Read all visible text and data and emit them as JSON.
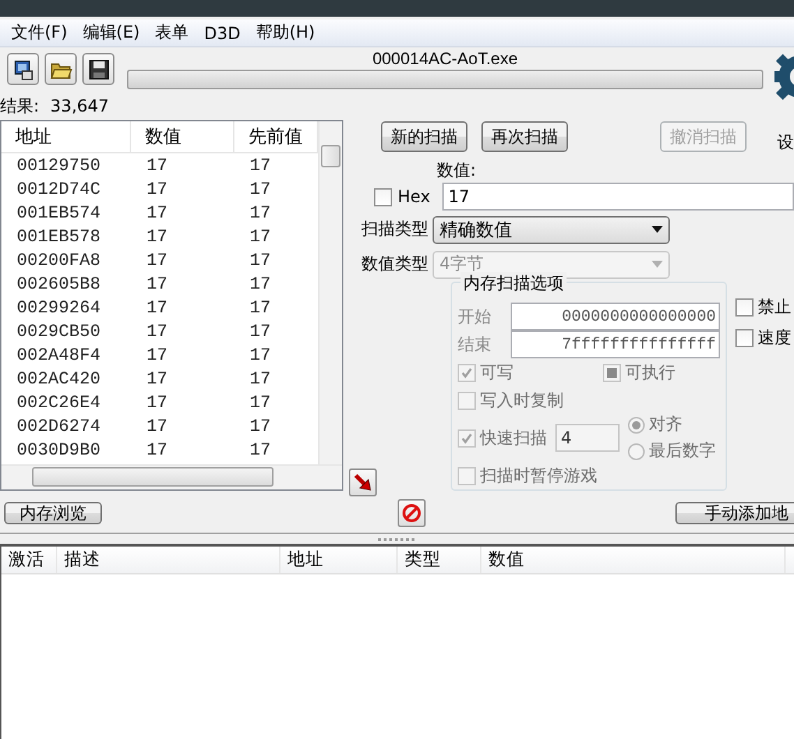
{
  "menu": [
    {
      "label": "文件(F)"
    },
    {
      "label": "编辑(E)"
    },
    {
      "label": "表单"
    },
    {
      "label": "D3D"
    },
    {
      "label": "帮助(H)"
    }
  ],
  "toolbar": {
    "process_name": "000014AC-AoT.exe",
    "progress": {
      "level": 0
    },
    "settings_label": "设"
  },
  "results": {
    "label": "结果:",
    "count": "33,647"
  },
  "scan_list": {
    "columns": [
      "地址",
      "数值",
      "先前值"
    ],
    "rows": [
      {
        "address": "00129750",
        "value": "17",
        "previous": "17"
      },
      {
        "address": "0012D74C",
        "value": "17",
        "previous": "17"
      },
      {
        "address": "001EB574",
        "value": "17",
        "previous": "17"
      },
      {
        "address": "001EB578",
        "value": "17",
        "previous": "17"
      },
      {
        "address": "00200FA8",
        "value": "17",
        "previous": "17"
      },
      {
        "address": "002605B8",
        "value": "17",
        "previous": "17"
      },
      {
        "address": "00299264",
        "value": "17",
        "previous": "17"
      },
      {
        "address": "0029CB50",
        "value": "17",
        "previous": "17"
      },
      {
        "address": "002A48F4",
        "value": "17",
        "previous": "17"
      },
      {
        "address": "002AC420",
        "value": "17",
        "previous": "17"
      },
      {
        "address": "002C26E4",
        "value": "17",
        "previous": "17"
      },
      {
        "address": "002D6274",
        "value": "17",
        "previous": "17"
      },
      {
        "address": "0030D9B0",
        "value": "17",
        "previous": "17"
      }
    ]
  },
  "scan_buttons": [
    {
      "label": "新的扫描",
      "disabled": false
    },
    {
      "label": "再次扫描",
      "disabled": false
    },
    {
      "label": "撤消扫描",
      "disabled": true
    }
  ],
  "value": {
    "label": "数值:",
    "hex": {
      "label": "Hex",
      "checked": false
    },
    "input": "17"
  },
  "scan_type": {
    "label": "扫描类型",
    "value": "精确数值",
    "disabled": false
  },
  "value_type": {
    "label": "数值类型",
    "value": "4字节",
    "disabled": true
  },
  "memory_scan_options": {
    "title": "内存扫描选项",
    "disabled": true,
    "start": {
      "label": "开始",
      "value": "0000000000000000"
    },
    "end": {
      "label": "结束",
      "value": "7fffffffffffffff"
    },
    "writable": {
      "label": "可写",
      "checked": true
    },
    "executable": {
      "label": "可执行",
      "indeterminate": true
    },
    "copy_on_write": {
      "label": "写入时复制",
      "checked": false
    },
    "fast_scan": {
      "label": "快速扫描",
      "checked": true,
      "value": "4"
    },
    "alignment": [
      {
        "label": "对齐",
        "selected": true
      },
      {
        "label": "最后数字",
        "selected": false
      }
    ],
    "pause_game": {
      "label": "扫描时暂停游戏",
      "checked": false
    }
  },
  "side_options": [
    {
      "label": "禁止",
      "checked": false
    },
    {
      "label": "速度",
      "checked": false
    }
  ],
  "memory_view_button": "内存浏览",
  "add_address_button": "手动添加地",
  "address_table": {
    "columns": [
      "激活",
      "描述",
      "地址",
      "类型",
      "数值"
    ]
  }
}
